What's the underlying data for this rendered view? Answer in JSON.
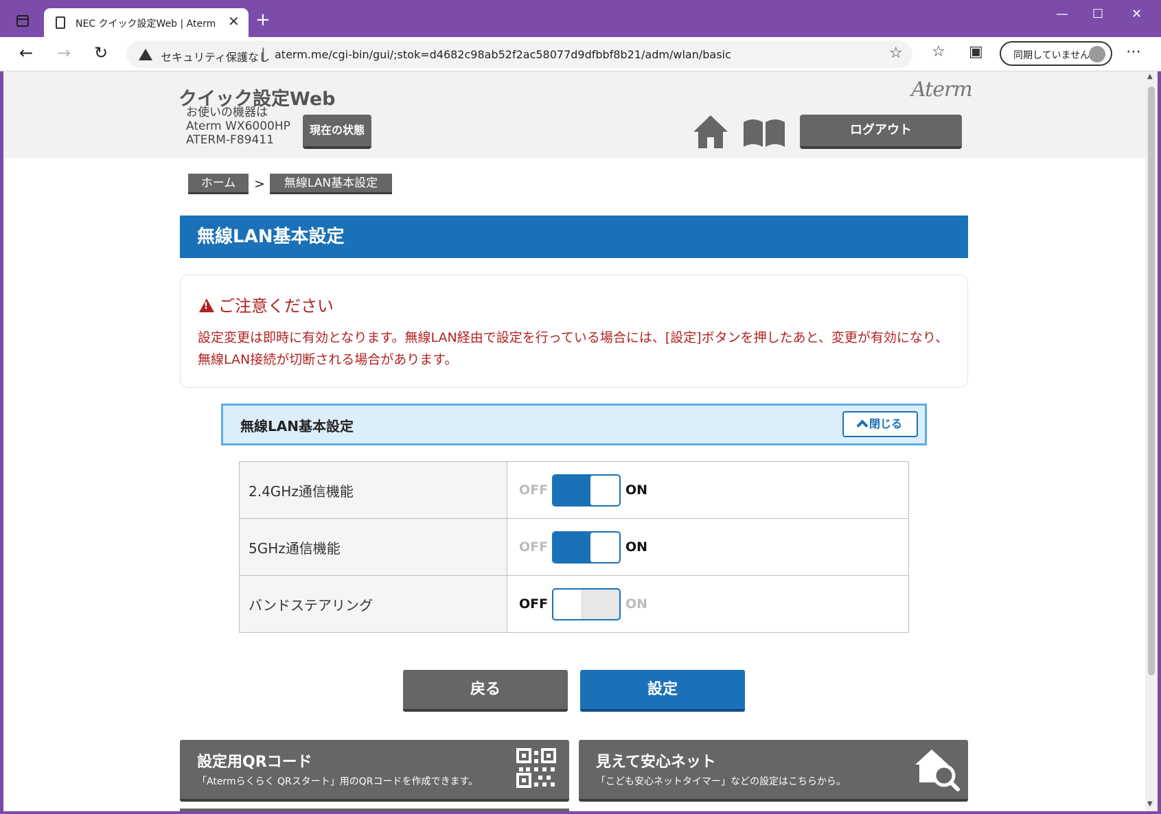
{
  "browser": {
    "tab_title": "NEC クイック設定Web | Aterm",
    "security_label": "セキュリティ保護なし",
    "url": "aterm.me/cgi-bin/gui/;stok=d4682c98ab52f2ac58077d9dfbbf8b21/adm/wlan/basic",
    "sync_label": "同期していません",
    "window_controls": {
      "minimize": "—",
      "maximize": "☐",
      "close": "✕"
    },
    "icons": [
      "tab-actions-icon",
      "page-icon",
      "back-arrow-icon",
      "forward-arrow-icon",
      "refresh-icon",
      "warning-icon",
      "add-favorite-icon",
      "favorites-icon",
      "collections-icon",
      "profile-avatar-icon",
      "more-menu-icon"
    ]
  },
  "header": {
    "site_title": "クイック設定Web",
    "device_line1": "お使いの機器は",
    "device_model": "Aterm WX6000HP",
    "device_id": "ATERM-F89411",
    "status_button": "現在の状態",
    "logout_button": "ログアウト",
    "brand": "Aterm",
    "icons": [
      "home-icon",
      "manual-book-icon"
    ]
  },
  "breadcrumb": {
    "home": "ホーム",
    "separator": ">",
    "current": "無線LAN基本設定"
  },
  "page_title": "無線LAN基本設定",
  "notice": {
    "title": "ご注意ください",
    "body": "設定変更は即時に有効となります。無線LAN経由で設定を行っている場合には、[設定]ボタンを押したあと、変更が有効になり、無線LAN接続が切断される場合があります。"
  },
  "section": {
    "title": "無線LAN基本設定",
    "close_label": "閉じる"
  },
  "settings": [
    {
      "label": "2.4GHz通信機能",
      "state": "on"
    },
    {
      "label": "5GHz通信機能",
      "state": "on"
    },
    {
      "label": "バンドステアリング",
      "state": "off"
    }
  ],
  "toggle_labels": {
    "off": "OFF",
    "on": "ON"
  },
  "buttons": {
    "back": "戻る",
    "apply": "設定"
  },
  "tiles": [
    {
      "title": "設定用QRコード",
      "desc": "「Atermらくらく QRスタート」用のQRコードを作成できます。",
      "icon": "qr-code-icon"
    },
    {
      "title": "見えて安心ネット",
      "desc": "「こども安心ネットタイマー」などの設定はこちらから。",
      "icon": "house-search-icon"
    }
  ],
  "colors": {
    "accent": "#1a71b8",
    "warning": "#b22222",
    "button_gray": "#666666",
    "titlebar": "#7b4ca9"
  }
}
